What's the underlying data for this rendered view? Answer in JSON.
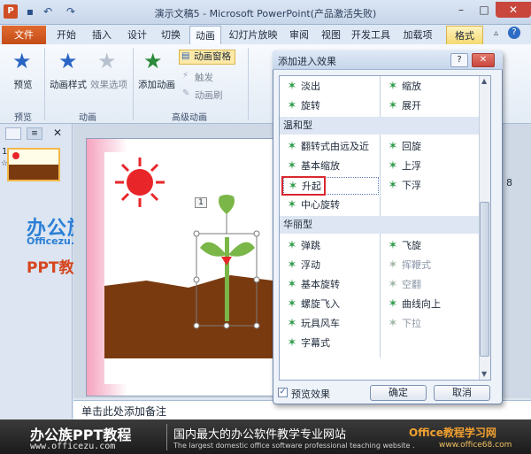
{
  "window": {
    "title": "演示文稿5 - Microsoft PowerPoint(产品激活失败)",
    "controls": {
      "minimize": "–",
      "maximize": "□",
      "close": "✕"
    }
  },
  "quick_access": {
    "save_icon": "save-icon",
    "undo": "↶",
    "redo": "↷"
  },
  "tabs": [
    {
      "label": "文件"
    },
    {
      "label": "开始"
    },
    {
      "label": "插入"
    },
    {
      "label": "设计"
    },
    {
      "label": "切换"
    },
    {
      "label": "动画"
    },
    {
      "label": "幻灯片放映"
    },
    {
      "label": "审阅"
    },
    {
      "label": "视图"
    },
    {
      "label": "开发工具"
    },
    {
      "label": "加载项"
    },
    {
      "label": "格式"
    }
  ],
  "ribbon": {
    "preview": "预览",
    "animation_style": "动画样式",
    "effect_options": "效果选项",
    "add_animation": "添加动画",
    "animation_pane": "动画窗格",
    "trigger": "触发",
    "animation_painter": "动画刷",
    "groups": {
      "preview": "预览",
      "animation": "动画",
      "advanced": "高级动画"
    }
  },
  "slide_panel": {
    "slide_number": "1",
    "transition_marker": "☆"
  },
  "slide": {
    "object_tag": "1"
  },
  "watermark": {
    "logo": "办公族",
    "url": "Officezu.com",
    "subtitle": "PPT教程"
  },
  "notes": {
    "placeholder": "单击此处添加备注"
  },
  "banner": {
    "brand": "办公族PPT教程",
    "brand_url": "www.officezu.com",
    "slogan": "国内最大的办公软件教学专业网站",
    "slogan_en": "The largest domestic office software professional teaching website .",
    "right_logo": "Office教程学习网",
    "right_url": "www.office68.com"
  },
  "dialog": {
    "title": "添加进入效果",
    "help": "?",
    "close": "✕",
    "top_items": [
      {
        "left": "淡出",
        "right": "缩放"
      },
      {
        "left": "旋转",
        "right": "展开"
      }
    ],
    "sections": [
      "温和型",
      "华丽型"
    ],
    "gentle_items": [
      {
        "left": "翻转式由远及近",
        "right": "回旋"
      },
      {
        "left": "基本缩放",
        "right": "上浮"
      },
      {
        "left": "升起",
        "right": "下浮"
      },
      {
        "left": "中心旋转",
        "right": ""
      }
    ],
    "fancy_items": [
      {
        "left": "弹跳",
        "right": "飞旋"
      },
      {
        "left": "浮动",
        "right": "挥鞭式"
      },
      {
        "left": "基本旋转",
        "right": "空翻"
      },
      {
        "left": "螺旋飞入",
        "right": "曲线向上"
      },
      {
        "left": "玩具风车",
        "right": "下拉"
      },
      {
        "left": "字幕式",
        "right": ""
      }
    ],
    "disabled_right_fancy": [
      "挥鞭式",
      "空翻",
      "下拉"
    ],
    "selected_item": "升起",
    "preview_checkbox": {
      "label": "预览效果",
      "checked": true
    },
    "ok": "确定",
    "cancel": "取消"
  },
  "colors": {
    "file_tab": "#c44d18",
    "sun": "#e8262a",
    "ground": "#7a3a10",
    "highlight_box": "#d9282f"
  }
}
